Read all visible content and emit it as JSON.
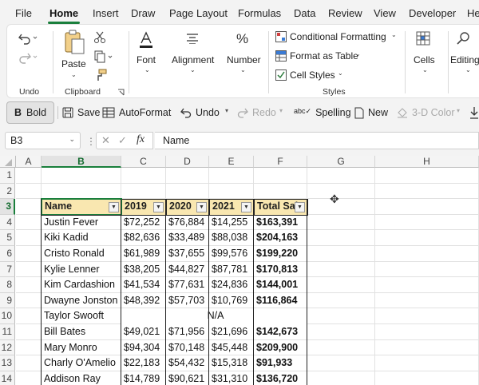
{
  "menu": {
    "tabs": [
      "File",
      "Home",
      "Insert",
      "Draw",
      "Page Layout",
      "Formulas",
      "Data",
      "Review",
      "View",
      "Developer",
      "He"
    ],
    "active": "Home"
  },
  "ribbon": {
    "undo_group_label": "Undo",
    "clipboard": {
      "paste_label": "Paste",
      "group_label": "Clipboard"
    },
    "font_label": "Font",
    "alignment_label": "Alignment",
    "number_label": "Number",
    "styles": {
      "conditional_formatting": "Conditional Formatting",
      "format_as_table": "Format as Table",
      "cell_styles": "Cell Styles",
      "group_label": "Styles"
    },
    "cells_label": "Cells",
    "editing_label": "Editing"
  },
  "quick_toolbar": {
    "bold": "Bold",
    "save": "Save",
    "autoformat": "AutoFormat",
    "undo": "Undo",
    "redo": "Redo",
    "spelling": "Spelling",
    "new": "New",
    "three_d_color": "3-D Color"
  },
  "formula_bar": {
    "name_box": "B3",
    "formula": "Name",
    "fx": "fx"
  },
  "sheet": {
    "columns": [
      "A",
      "B",
      "C",
      "D",
      "E",
      "F",
      "G",
      "H"
    ],
    "selected_column": "B",
    "rows": [
      "1",
      "2",
      "3",
      "4",
      "5",
      "6",
      "7",
      "8",
      "9",
      "10",
      "11",
      "12",
      "13",
      "14"
    ],
    "selected_row": "3",
    "table_headers": [
      "Name",
      "2019",
      "2020",
      "2021",
      "Total Sal"
    ],
    "table_rows": [
      [
        "Justin Fever",
        "$72,252",
        "$76,884",
        "$14,255",
        "$163,391"
      ],
      [
        "Kiki Kadid",
        "$82,636",
        "$33,489",
        "$88,038",
        "$204,163"
      ],
      [
        "Cristo Ronald",
        "$61,989",
        "$37,655",
        "$99,576",
        "$199,220"
      ],
      [
        "Kylie Lenner",
        "$38,205",
        "$44,827",
        "$87,781",
        "$170,813"
      ],
      [
        "Kim Cardashion",
        "$41,534",
        "$77,631",
        "$24,836",
        "$144,001"
      ],
      [
        "Dwayne Jonston",
        "$48,392",
        "$57,703",
        "$10,769",
        "$116,864"
      ],
      [
        "Taylor Swooft",
        "",
        "",
        "",
        ""
      ],
      [
        "Bill Bates",
        "$49,021",
        "$71,956",
        "$21,696",
        "$142,673"
      ],
      [
        "Mary Monro",
        "$94,304",
        "$70,148",
        "$45,448",
        "$209,900"
      ],
      [
        "Charly O'Amelio",
        "$22,183",
        "$54,432",
        "$15,318",
        "$91,933"
      ],
      [
        "Addison Ray",
        "$14,789",
        "$90,621",
        "$31,310",
        "$136,720"
      ]
    ],
    "merged_na": "N/A"
  },
  "colors": {
    "accent": "#1a7f3c",
    "header_fill": "#f9e7b0"
  }
}
